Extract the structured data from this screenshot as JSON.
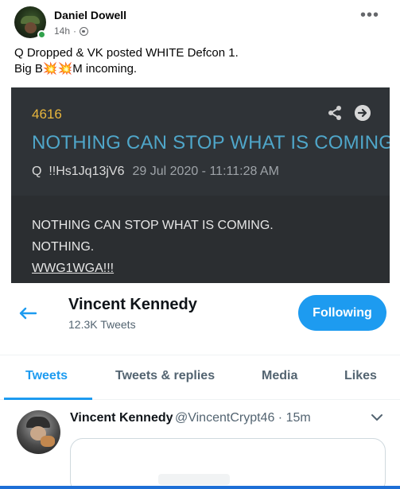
{
  "facebook_post": {
    "author": "Daniel Dowell",
    "time": "14h",
    "separator": "·",
    "icons": {
      "privacy": "globe-icon",
      "options": "more-options-icon"
    },
    "text_line1": "Q Dropped & VK posted WHITE Defcon 1.",
    "text_line2_a": "Big B",
    "text_line2_emoji1": "💥",
    "text_line2_emoji2": "💥",
    "text_line2_b": "M incoming."
  },
  "q_post": {
    "number": "4616",
    "title": "NOTHING CAN STOP WHAT IS COMING",
    "author": "Q  !!Hs1Jq13jV6",
    "date": "29 Jul 2020 - 11:11:28 AM",
    "body_line1": "NOTHING CAN STOP WHAT IS COMING.",
    "body_line2": "NOTHING.",
    "body_line3": "WWG1WGA!!!",
    "colors": {
      "number": "#e8b63d",
      "title": "#4fa6c9",
      "background": "#2b2e31"
    },
    "icons": {
      "share": "share-icon",
      "open": "arrow-right-circle-icon"
    }
  },
  "twitter_profile": {
    "name": "Vincent Kennedy",
    "tweet_count": "12.3K Tweets",
    "follow_button": "Following",
    "tabs": [
      {
        "label": "Tweets",
        "active": true
      },
      {
        "label": "Tweets & replies",
        "active": false
      },
      {
        "label": "Media",
        "active": false
      },
      {
        "label": "Likes",
        "active": false
      }
    ],
    "tweet": {
      "name": "Vincent Kennedy",
      "handle": "@VincentCrypt46",
      "separator": "·",
      "time": "15m"
    },
    "colors": {
      "accent": "#1d9bf0"
    }
  }
}
